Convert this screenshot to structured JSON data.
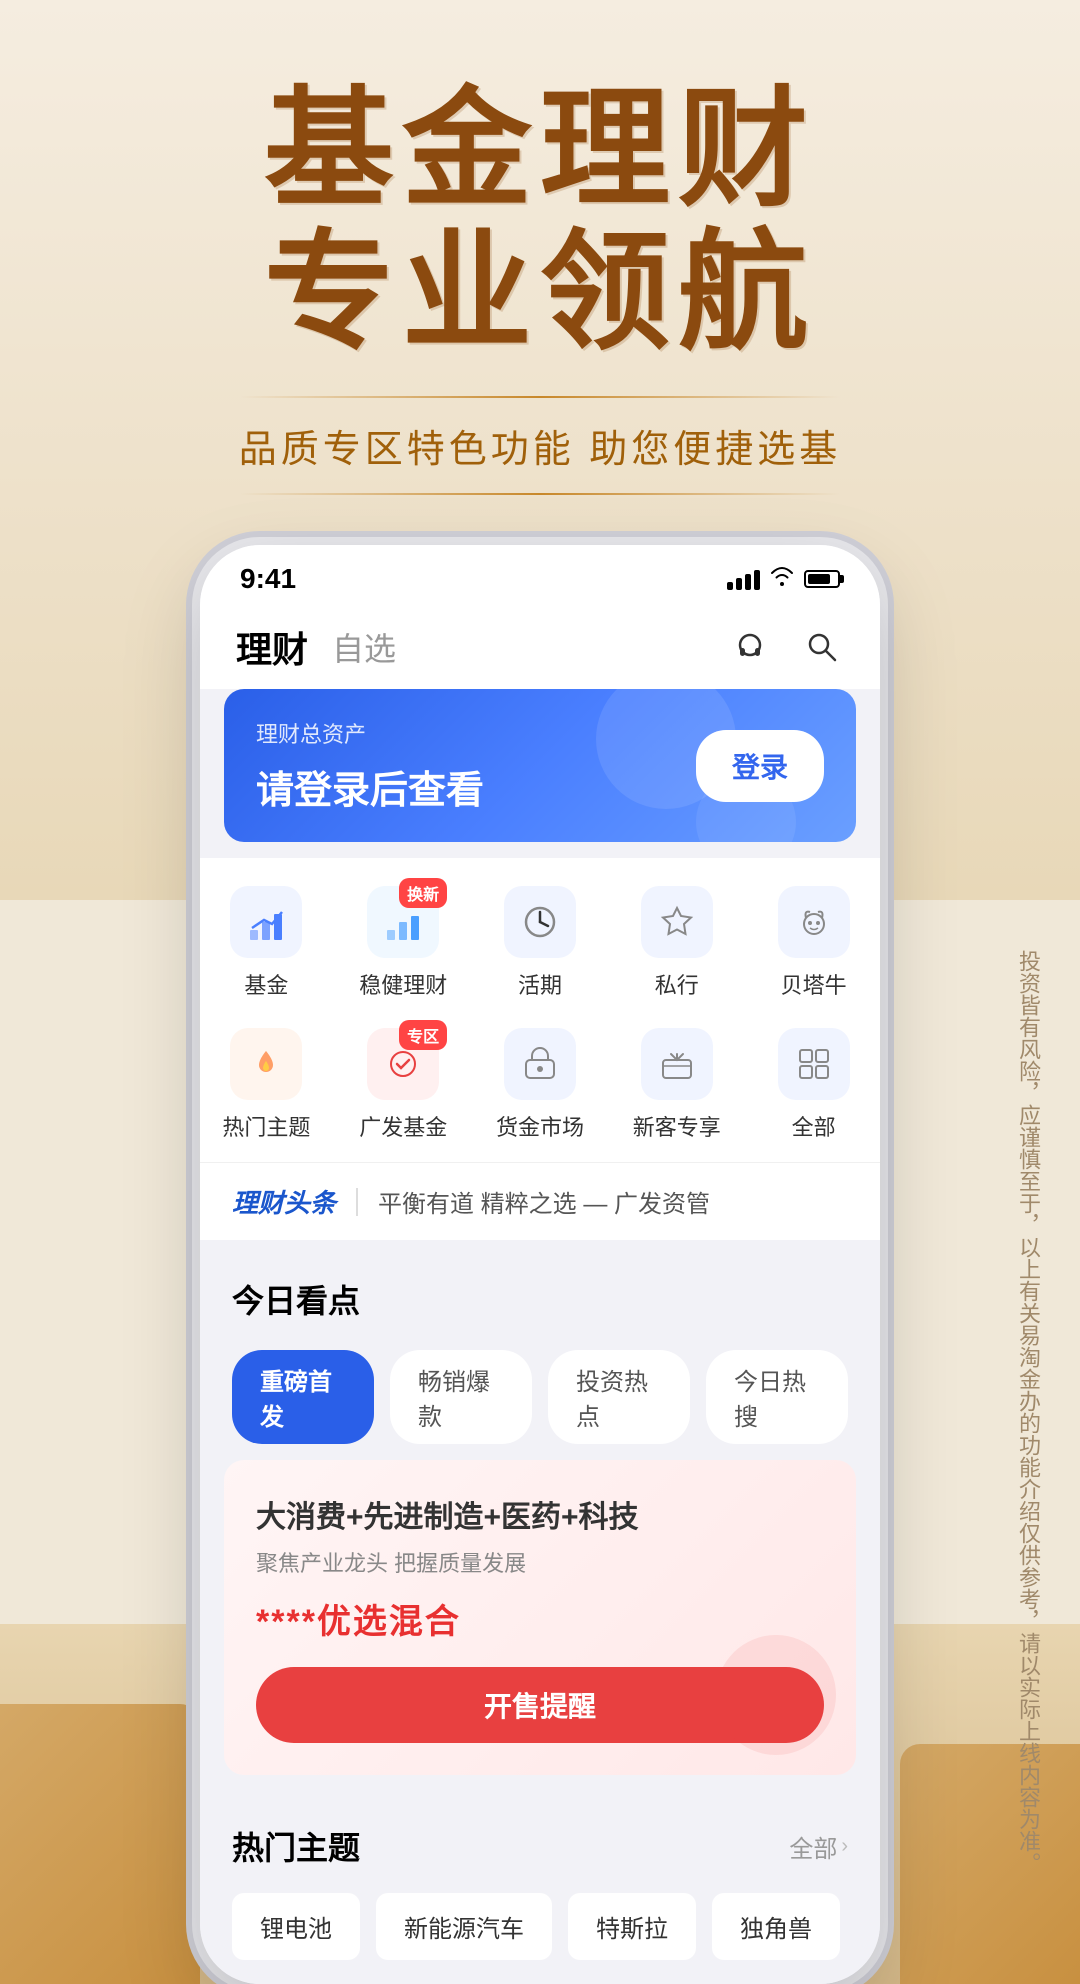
{
  "page": {
    "background_color": "#f0e8d8"
  },
  "hero": {
    "title_line1": "基金理财",
    "title_line2": "专业领航",
    "subtitle": "品质专区特色功能 助您便捷选基"
  },
  "phone": {
    "status_bar": {
      "time": "9:41",
      "signal_bars": 4,
      "wifi": true,
      "battery_percent": 80
    },
    "nav": {
      "title_active": "理财",
      "title_inactive": "自选"
    },
    "banner": {
      "label": "理财总资产",
      "main_text": "请登录后查看",
      "login_btn": "登录"
    },
    "menu_items": [
      {
        "id": "jijin",
        "label": "基金",
        "icon": "📈",
        "badge": null
      },
      {
        "id": "wenjian",
        "label": "稳健理财",
        "icon": "📊",
        "badge": "换新"
      },
      {
        "id": "huoqi",
        "label": "活期",
        "icon": "⏰",
        "badge": null
      },
      {
        "id": "sixing",
        "label": "私行",
        "icon": "👑",
        "badge": null
      },
      {
        "id": "beitaaniu",
        "label": "贝塔牛",
        "icon": "🐮",
        "badge": null
      },
      {
        "id": "remen",
        "label": "热门主题",
        "icon": "🔥",
        "badge": null
      },
      {
        "id": "guangfa",
        "label": "广发基金",
        "icon": "🎯",
        "badge": "专区"
      },
      {
        "id": "huojin",
        "label": "货金市场",
        "icon": "🏦",
        "badge": null
      },
      {
        "id": "xin",
        "label": "新客专享",
        "icon": "🎁",
        "badge": null
      },
      {
        "id": "quanbu",
        "label": "全部",
        "icon": "⊞",
        "badge": null
      }
    ],
    "news_ticker": {
      "brand": "理财头条",
      "divider": "|",
      "text": "平衡有道 精粹之选 — 广发资管"
    },
    "today_section": {
      "title": "今日看点",
      "filter_tabs": [
        {
          "label": "重磅首发",
          "active": true
        },
        {
          "label": "畅销爆款",
          "active": false
        },
        {
          "label": "投资热点",
          "active": false
        },
        {
          "label": "今日热搜",
          "active": false
        }
      ]
    },
    "fund_card": {
      "title": "大消费+先进制造+医药+科技",
      "subtitle": "聚焦产业龙头 把握质量发展",
      "name": "****优选混合",
      "btn_label": "开售提醒"
    },
    "hot_themes": {
      "title": "热门主题",
      "more_label": "全部",
      "tags": [
        {
          "label": "锂电池"
        },
        {
          "label": "新能源汽车"
        },
        {
          "label": "特斯拉"
        },
        {
          "label": "独角兽"
        }
      ]
    }
  },
  "side_text": "投资皆有风险，应谨慎至于，以上有关易淘金办的功能介绍仅供参考，请以实际上线内容为准。",
  "bottom_boxes": {
    "left": true,
    "right": true
  }
}
